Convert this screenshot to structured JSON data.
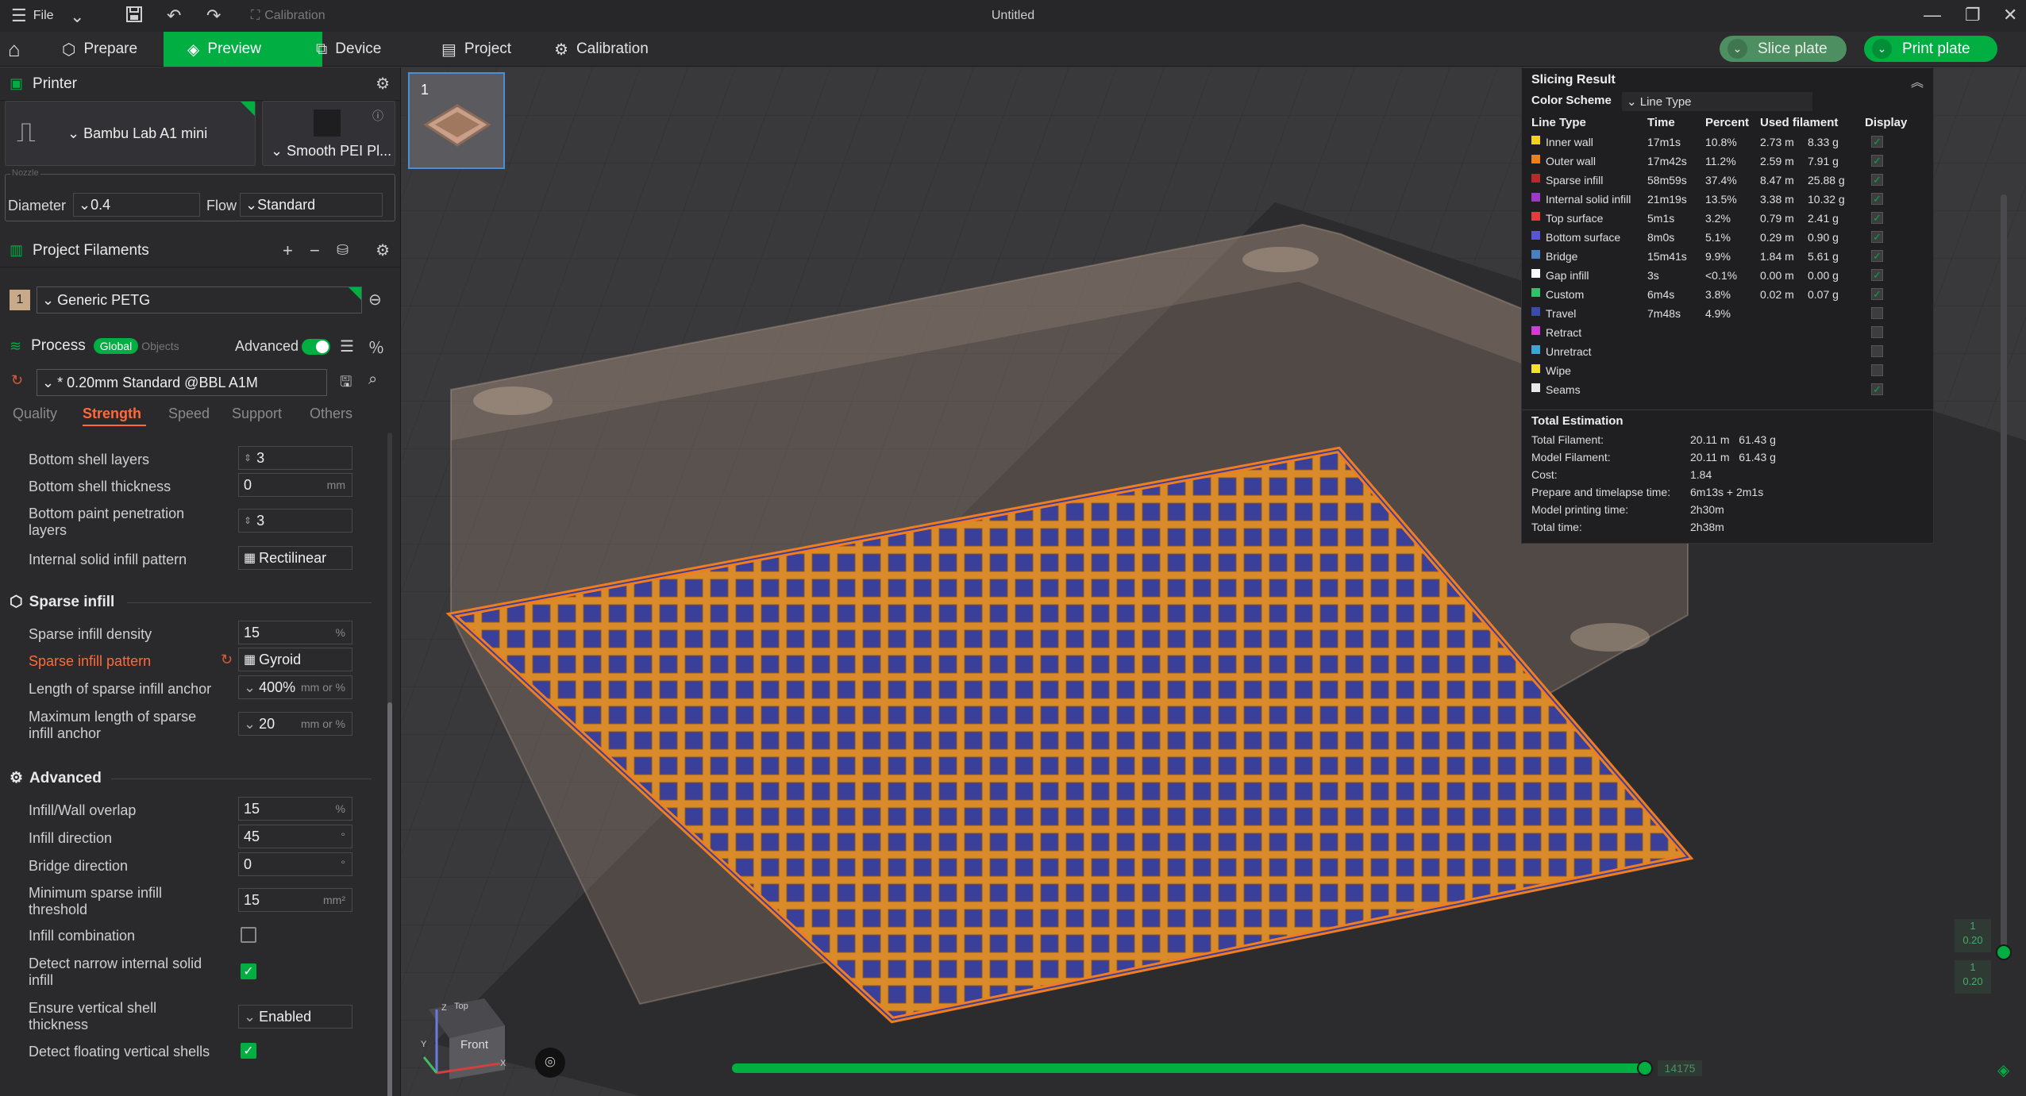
{
  "titlebar": {
    "file": "File",
    "calibration": "Calibration",
    "title": "Untitled"
  },
  "tabs": {
    "prepare": "Prepare",
    "preview": "Preview",
    "device": "Device",
    "project": "Project",
    "calibration": "Calibration"
  },
  "actions": {
    "slice": "Slice plate",
    "print": "Print plate"
  },
  "printer": {
    "section": "Printer",
    "model": "Bambu Lab A1 mini",
    "plate": "Smooth PEI Pl...",
    "nozzle_legend": "Nozzle",
    "diameter_label": "Diameter",
    "diameter": "0.4",
    "flow_label": "Flow",
    "flow": "Standard"
  },
  "filaments": {
    "section": "Project Filaments",
    "index": "1",
    "name": "Generic PETG"
  },
  "process": {
    "section": "Process",
    "global": "Global",
    "objects": "Objects",
    "advanced_label": "Advanced",
    "preset": "* 0.20mm Standard @BBL A1M",
    "tabs": [
      "Quality",
      "Strength",
      "Speed",
      "Support",
      "Others"
    ],
    "active_tab": "Strength"
  },
  "settings": {
    "bottom_shell_layers": {
      "label": "Bottom shell layers",
      "value": "3"
    },
    "bottom_shell_thickness": {
      "label": "Bottom shell thickness",
      "value": "0",
      "unit": "mm"
    },
    "bottom_paint": {
      "label1": "Bottom paint penetration",
      "label2": "layers",
      "value": "3"
    },
    "internal_solid_pattern": {
      "label": "Internal solid infill pattern",
      "value": "Rectilinear"
    },
    "sparse_head": "Sparse infill",
    "sparse_density": {
      "label": "Sparse infill density",
      "value": "15",
      "unit": "%"
    },
    "sparse_pattern": {
      "label": "Sparse infill pattern",
      "value": "Gyroid"
    },
    "anchor_length": {
      "label": "Length of sparse infill anchor",
      "value": "400%",
      "unit": "mm or %"
    },
    "anchor_max": {
      "label1": "Maximum length of sparse",
      "label2": "infill anchor",
      "value": "20",
      "unit": "mm or %"
    },
    "advanced_head": "Advanced",
    "wall_overlap": {
      "label": "Infill/Wall overlap",
      "value": "15",
      "unit": "%"
    },
    "infill_direction": {
      "label": "Infill direction",
      "value": "45",
      "unit": "°"
    },
    "bridge_direction": {
      "label": "Bridge direction",
      "value": "0",
      "unit": "°"
    },
    "min_sparse": {
      "label1": "Minimum sparse infill",
      "label2": "threshold",
      "value": "15",
      "unit": "mm²"
    },
    "infill_combination": {
      "label": "Infill combination",
      "checked": false
    },
    "narrow_internal": {
      "label1": "Detect narrow internal solid",
      "label2": "infill",
      "checked": true
    },
    "vertical_shell": {
      "label1": "Ensure vertical shell",
      "label2": "thickness",
      "value": "Enabled"
    },
    "floating_shells": {
      "label": "Detect floating vertical shells",
      "checked": true
    }
  },
  "result": {
    "title": "Slicing Result",
    "color_scheme_label": "Color Scheme",
    "color_scheme": "Line Type",
    "headers": [
      "Line Type",
      "Time",
      "Percent",
      "Used filament",
      "Display"
    ],
    "rows": [
      {
        "name": "Inner wall",
        "time": "17m1s",
        "percent": "10.8%",
        "length": "2.73 m",
        "weight": "8.33 g",
        "color": "#f2d31a",
        "display": true
      },
      {
        "name": "Outer wall",
        "time": "17m42s",
        "percent": "11.2%",
        "length": "2.59 m",
        "weight": "7.91 g",
        "color": "#f07d1e",
        "display": true
      },
      {
        "name": "Sparse infill",
        "time": "58m59s",
        "percent": "37.4%",
        "length": "8.47 m",
        "weight": "25.88 g",
        "color": "#b52a2a",
        "display": true
      },
      {
        "name": "Internal solid infill",
        "time": "21m19s",
        "percent": "13.5%",
        "length": "3.38 m",
        "weight": "10.32 g",
        "color": "#9a3bc7",
        "display": true
      },
      {
        "name": "Top surface",
        "time": "5m1s",
        "percent": "3.2%",
        "length": "0.79 m",
        "weight": "2.41 g",
        "color": "#e83a3a",
        "display": true
      },
      {
        "name": "Bottom surface",
        "time": "8m0s",
        "percent": "5.1%",
        "length": "0.29 m",
        "weight": "0.90 g",
        "color": "#5a55d6",
        "display": true
      },
      {
        "name": "Bridge",
        "time": "15m41s",
        "percent": "9.9%",
        "length": "1.84 m",
        "weight": "5.61 g",
        "color": "#4a7fc1",
        "display": true
      },
      {
        "name": "Gap infill",
        "time": "3s",
        "percent": "<0.1%",
        "length": "0.00 m",
        "weight": "0.00 g",
        "color": "#ffffff",
        "display": true
      },
      {
        "name": "Custom",
        "time": "6m4s",
        "percent": "3.8%",
        "length": "0.02 m",
        "weight": "0.07 g",
        "color": "#2fc26a",
        "display": true
      },
      {
        "name": "Travel",
        "time": "7m48s",
        "percent": "4.9%",
        "length": "",
        "weight": "",
        "color": "#3b4ba8",
        "display": false
      },
      {
        "name": "Retract",
        "time": "",
        "percent": "",
        "length": "",
        "weight": "",
        "color": "#d43bd4",
        "display": false
      },
      {
        "name": "Unretract",
        "time": "",
        "percent": "",
        "length": "",
        "weight": "",
        "color": "#3aa6d4",
        "display": false
      },
      {
        "name": "Wipe",
        "time": "",
        "percent": "",
        "length": "",
        "weight": "",
        "color": "#f5e02a",
        "display": false
      },
      {
        "name": "Seams",
        "time": "",
        "percent": "",
        "length": "",
        "weight": "",
        "color": "#e8e8e8",
        "display": true
      }
    ],
    "total_title": "Total Estimation",
    "totals": [
      {
        "label": "Total Filament:",
        "value": "20.11 m   61.43 g"
      },
      {
        "label": "Model Filament:",
        "value": "20.11 m   61.43 g"
      },
      {
        "label": "Cost:",
        "value": "1.84"
      },
      {
        "label": "Prepare and timelapse time:",
        "value": "6m13s + 2m1s"
      },
      {
        "label": "Model printing time:",
        "value": "2h30m"
      },
      {
        "label": "Total time:",
        "value": "2h38m"
      }
    ]
  },
  "viewport": {
    "plate_number": "1",
    "layer_top": {
      "n": "1",
      "z": "0.20"
    },
    "layer_bottom": {
      "n": "1",
      "z": "0.20"
    },
    "move_count": "14175",
    "move_progress": 1.0,
    "axes": {
      "z": "Z",
      "top": "Top",
      "front": "Front",
      "y": "Y",
      "x": "X"
    }
  }
}
